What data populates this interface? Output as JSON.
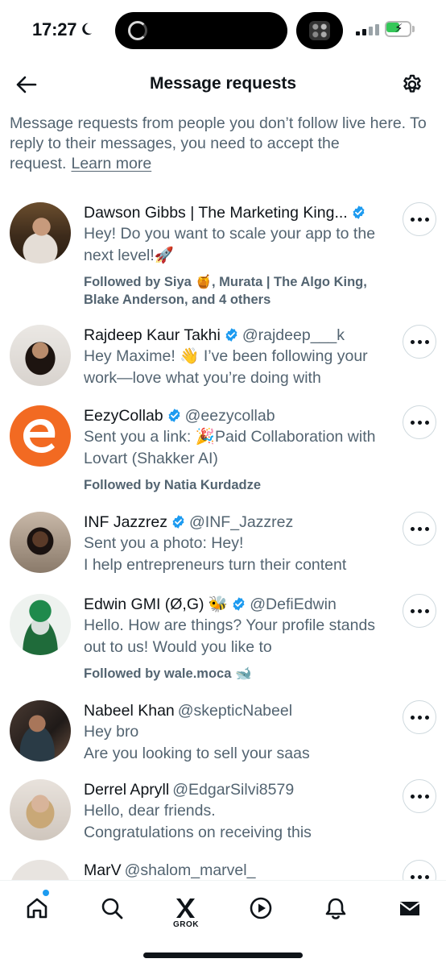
{
  "status_bar": {
    "time": "17:27",
    "battery_color": "#34c759"
  },
  "header": {
    "title": "Message requests",
    "back_icon": "arrow-left-icon",
    "settings_icon": "gear-icon"
  },
  "intro": {
    "text": "Message requests from people you don’t follow live here. To reply to their messages, you need to accept the request.",
    "link": "Learn more"
  },
  "requests": [
    {
      "name": "Dawson Gibbs | The Marketing King...",
      "handle": "",
      "verified": true,
      "message": "Hey! Do you want to scale your app to the next level!🚀",
      "followed_by": "Followed by Siya 🍯, Murata | The Algo King, Blake Anderson, and 4 others"
    },
    {
      "name": "Rajdeep Kaur Takhi",
      "handle": "@rajdeep___k",
      "verified": true,
      "message": "Hey Maxime! 👋 I’ve been following your work—love what you’re doing with",
      "followed_by": ""
    },
    {
      "name": "EezyCollab",
      "handle": "@eezycollab",
      "verified": true,
      "message": "Sent you a link: 🎉Paid Collaboration with Lovart (Shakker AI)",
      "followed_by": "Followed by Natia Kurdadze"
    },
    {
      "name": "INF Jazzrez",
      "handle": "@INF_Jazzrez",
      "verified": true,
      "message": "Sent you a photo: Hey!\nI help entrepreneurs turn their content",
      "followed_by": ""
    },
    {
      "name": "Edwin GMI (Ø,G) 🐝",
      "handle": "@DefiEdwin",
      "verified": true,
      "message": "Hello. How are things? Your profile stands out to us! Would you like to",
      "followed_by": "Followed by wale.moca 🐋"
    },
    {
      "name": "Nabeel Khan",
      "handle": "@skepticNabeel",
      "verified": false,
      "message": "Hey bro\nAre you looking to sell your saas",
      "followed_by": ""
    },
    {
      "name": "Derrel Apryll",
      "handle": "@EdgarSilvi8579",
      "verified": false,
      "message": "Hello, dear friends.\nCongratulations on receiving this",
      "followed_by": ""
    },
    {
      "name": "MarV",
      "handle": "@shalom_marvel_",
      "verified": false,
      "message": "",
      "followed_by": ""
    }
  ],
  "tabbar": {
    "items": [
      "home-icon",
      "search-icon",
      "grok-icon",
      "video-icon",
      "notifications-icon",
      "messages-icon"
    ],
    "grok_label": "GROK"
  },
  "colors": {
    "verified": "#1d9bf0",
    "secondary_text": "#536471",
    "primary_text": "#0f1419"
  }
}
